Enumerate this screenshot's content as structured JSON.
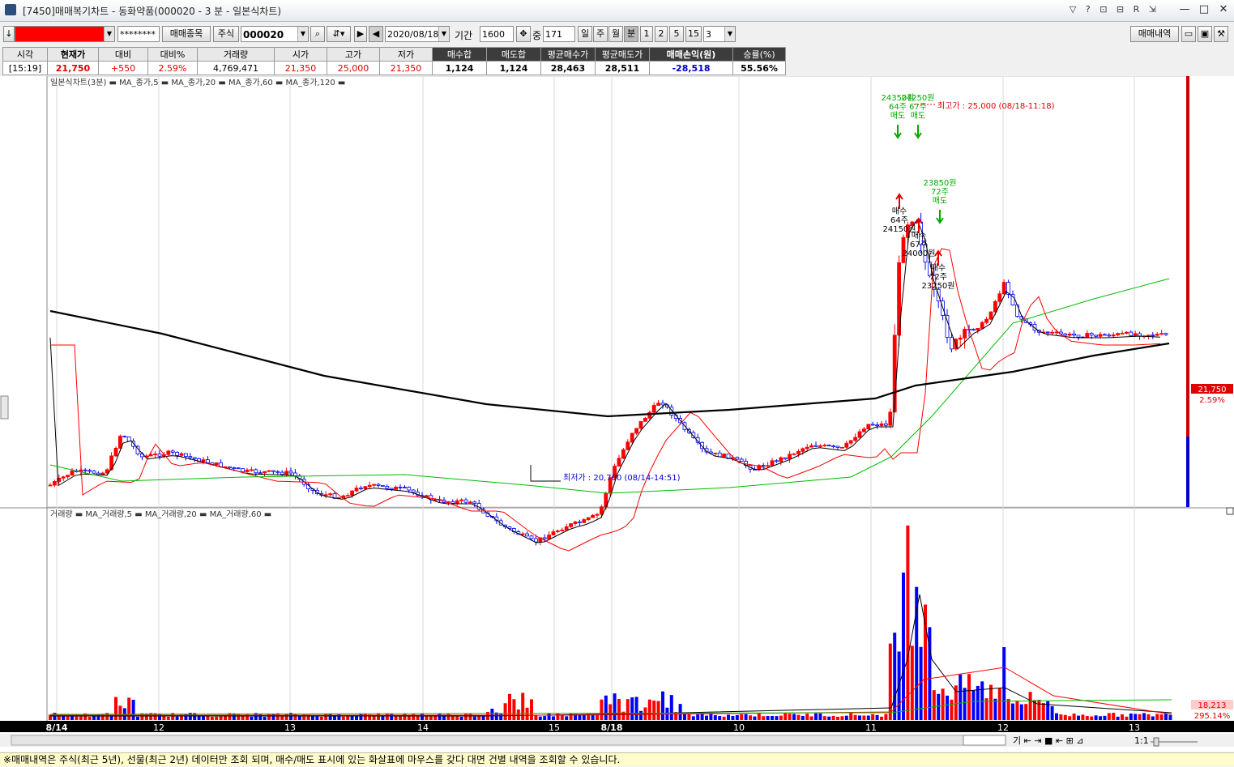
{
  "window": {
    "title": "[7450]매매복기차트 - 동화약품(000020 - 3 분 - 일본식차트)",
    "icon_strip": "▽ ? ⊡ ⊟ R ⇲",
    "minimize": "—",
    "maximize": "□",
    "close": "✕"
  },
  "toolbar": {
    "account_masked": "********",
    "trade_items_label": "매매종목",
    "market_type": "주식",
    "code": "000020",
    "date": "2020/08/18",
    "period_label": "기간",
    "period_value": "1600",
    "mid_label": "중",
    "mid_value": "171",
    "tab_day": "일",
    "tab_week": "주",
    "tab_month": "월",
    "tab_minute": "분",
    "interval_options": [
      "1",
      "2",
      "5",
      "15"
    ],
    "interval_value": "3",
    "history_button": "매매내역",
    "account_color": "#ff0000"
  },
  "summary": {
    "headers": [
      "시각",
      "현재가",
      "대비",
      "대비%",
      "거래량",
      "시가",
      "고가",
      "저가",
      "매수합",
      "매도합",
      "평균매수가",
      "평균매도가",
      "매매손익(원)",
      "승률(%)"
    ],
    "values": [
      "[15:19]",
      "21,750",
      "+550",
      "2.59%",
      "4,769,471",
      "21,350",
      "25,000",
      "21,350",
      "1,124",
      "1,124",
      "28,463",
      "28,511",
      "-28,518",
      "55.56%"
    ]
  },
  "chart": {
    "price_legend": "일본식차트(3분) ▬ MA_종가,5 ▬ MA_종가,20 ▬ MA_종가,60 ▬ MA_종가,120 ▬",
    "volume_legend": "거래량 ▬ MA_거래량,5 ▬ MA_거래량,20 ▬ MA_거래량,60 ▬",
    "high_label": "최고가 : 25,000 (08/18-11:18)",
    "low_label": "최저가 : 20,700 (08/14-14:51)",
    "current_price": "21,750",
    "current_pct": "2.59%",
    "volume_value": "18,213",
    "volume_pct": "295.14%",
    "x_labels": [
      "8/14",
      "12",
      "13",
      "14",
      "15",
      "8/18",
      "10",
      "11",
      "12",
      "13"
    ],
    "trade_marks": [
      {
        "type": "sell",
        "lines": [
          "24350원",
          "64주",
          "매도"
        ]
      },
      {
        "type": "sell",
        "lines": [
          "24250원",
          "67주",
          "매도"
        ]
      },
      {
        "type": "sell",
        "lines": [
          "23850원",
          "72주",
          "매도"
        ]
      },
      {
        "type": "buy",
        "lines": [
          "매수",
          "64주",
          "24150원"
        ]
      },
      {
        "type": "buy",
        "lines": [
          "매수",
          "67주",
          "24000원"
        ]
      },
      {
        "type": "buy",
        "lines": [
          "매수",
          "72주",
          "23250원"
        ]
      }
    ],
    "colors": {
      "up": "#ff0000",
      "down": "#0000ff",
      "ma5": "#000000",
      "ma20": "#ff0000",
      "ma60": "#00bb00",
      "ma120": "#000000"
    }
  },
  "nav": {
    "zoom_ratio": "1:1",
    "tool_glyphs": "기 ⇤ ⇥ ■ ⇤ ⊞ ⊿"
  },
  "status": {
    "message": "※매매내역은 주식(최근 5년), 선물(최근 2년) 데이터만 조회 되며, 매수/매도 표시에 있는 화살표에 마우스를 갖다 대면 건별 내역을 조회할 수 있습니다."
  }
}
